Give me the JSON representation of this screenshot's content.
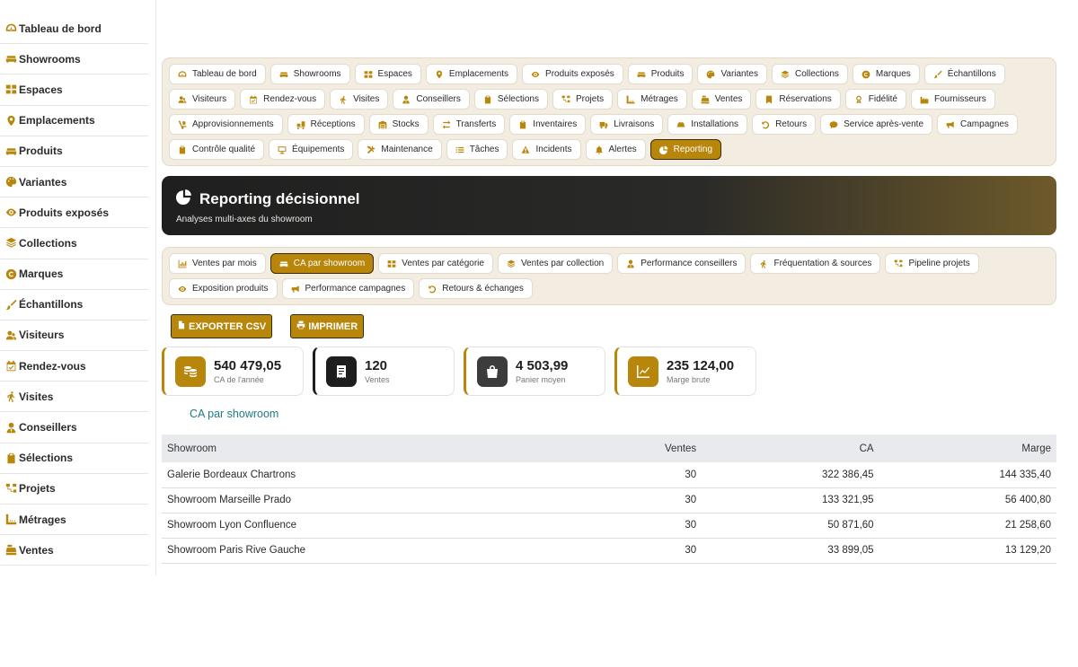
{
  "sidebar": {
    "items": [
      {
        "label": "Tableau de bord",
        "icon": "gauge-icon"
      },
      {
        "label": "Showrooms",
        "icon": "couch-icon"
      },
      {
        "label": "Espaces",
        "icon": "grid-icon"
      },
      {
        "label": "Emplacements",
        "icon": "map-pin-icon"
      },
      {
        "label": "Produits",
        "icon": "couch-icon"
      },
      {
        "label": "Variantes",
        "icon": "palette-icon"
      },
      {
        "label": "Produits exposés",
        "icon": "eye-icon"
      },
      {
        "label": "Collections",
        "icon": "layers-icon"
      },
      {
        "label": "Marques",
        "icon": "copyright-icon"
      },
      {
        "label": "Échantillons",
        "icon": "brush-icon"
      },
      {
        "label": "Visiteurs",
        "icon": "users-icon"
      },
      {
        "label": "Rendez-vous",
        "icon": "calendar-check-icon"
      },
      {
        "label": "Visites",
        "icon": "walking-icon"
      },
      {
        "label": "Conseillers",
        "icon": "user-tie-icon"
      },
      {
        "label": "Sélections",
        "icon": "clipboard-icon"
      },
      {
        "label": "Projets",
        "icon": "diagram-icon"
      },
      {
        "label": "Métrages",
        "icon": "ruler-icon"
      },
      {
        "label": "Ventes",
        "icon": "cash-register-icon"
      }
    ]
  },
  "modules": [
    {
      "label": "Tableau de bord",
      "icon": "gauge-icon"
    },
    {
      "label": "Showrooms",
      "icon": "couch-icon"
    },
    {
      "label": "Espaces",
      "icon": "grid-icon"
    },
    {
      "label": "Emplacements",
      "icon": "map-pin-icon"
    },
    {
      "label": "Produits exposés",
      "icon": "eye-icon"
    },
    {
      "label": "Produits",
      "icon": "couch-icon"
    },
    {
      "label": "Variantes",
      "icon": "palette-icon"
    },
    {
      "label": "Collections",
      "icon": "layers-icon"
    },
    {
      "label": "Marques",
      "icon": "copyright-icon"
    },
    {
      "label": "Échantillons",
      "icon": "brush-icon"
    },
    {
      "label": "Visiteurs",
      "icon": "users-icon"
    },
    {
      "label": "Rendez-vous",
      "icon": "calendar-check-icon"
    },
    {
      "label": "Visites",
      "icon": "walking-icon"
    },
    {
      "label": "Conseillers",
      "icon": "user-tie-icon"
    },
    {
      "label": "Sélections",
      "icon": "clipboard-icon"
    },
    {
      "label": "Projets",
      "icon": "diagram-icon"
    },
    {
      "label": "Métrages",
      "icon": "ruler-icon"
    },
    {
      "label": "Ventes",
      "icon": "cash-register-icon"
    },
    {
      "label": "Réservations",
      "icon": "bookmark-icon"
    },
    {
      "label": "Fidélité",
      "icon": "award-icon"
    },
    {
      "label": "Fournisseurs",
      "icon": "industry-icon"
    },
    {
      "label": "Approvisionnements",
      "icon": "dolly-icon"
    },
    {
      "label": "Réceptions",
      "icon": "truck-loading-icon"
    },
    {
      "label": "Stocks",
      "icon": "warehouse-icon"
    },
    {
      "label": "Transferts",
      "icon": "exchange-icon"
    },
    {
      "label": "Inventaires",
      "icon": "clipboard-check-icon"
    },
    {
      "label": "Livraisons",
      "icon": "truck-icon"
    },
    {
      "label": "Installations",
      "icon": "hard-hat-icon"
    },
    {
      "label": "Retours",
      "icon": "undo-icon"
    },
    {
      "label": "Service après-vente",
      "icon": "comment-icon"
    },
    {
      "label": "Campagnes",
      "icon": "megaphone-icon"
    },
    {
      "label": "Contrôle qualité",
      "icon": "clipboard-icon"
    },
    {
      "label": "Équipements",
      "icon": "monitor-icon"
    },
    {
      "label": "Maintenance",
      "icon": "tools-icon"
    },
    {
      "label": "Tâches",
      "icon": "list-icon"
    },
    {
      "label": "Incidents",
      "icon": "warning-icon"
    },
    {
      "label": "Alertes",
      "icon": "bell-icon"
    },
    {
      "label": "Reporting",
      "icon": "pie-chart-icon",
      "active": true
    }
  ],
  "hero": {
    "title": "Reporting décisionnel",
    "subtitle": "Analyses multi-axes du showroom",
    "icon": "pie-chart-icon"
  },
  "reports": [
    {
      "label": "Ventes par mois",
      "icon": "chart-bar-icon"
    },
    {
      "label": "CA par showroom",
      "icon": "couch-icon",
      "active": true
    },
    {
      "label": "Ventes par catégorie",
      "icon": "grid-icon"
    },
    {
      "label": "Ventes par collection",
      "icon": "layers-icon"
    },
    {
      "label": "Performance conseillers",
      "icon": "user-tie-icon"
    },
    {
      "label": "Fréquentation & sources",
      "icon": "walking-icon"
    },
    {
      "label": "Pipeline projets",
      "icon": "diagram-icon"
    },
    {
      "label": "Exposition produits",
      "icon": "eye-icon"
    },
    {
      "label": "Performance campagnes",
      "icon": "megaphone-icon"
    },
    {
      "label": "Retours & échanges",
      "icon": "undo-icon"
    }
  ],
  "actions": {
    "export_label": "EXPORTER CSV",
    "print_label": "IMPRIMER"
  },
  "kpis": [
    {
      "value": "540 479,05",
      "label": "CA de l'année",
      "icon": "coins-icon",
      "tone": "#b8860b"
    },
    {
      "value": "120",
      "label": "Ventes",
      "icon": "receipt-icon",
      "tone": "#1e1e1e"
    },
    {
      "value": "4 503,99",
      "label": "Panier moyen",
      "icon": "shopping-bag-icon",
      "tone": "#3c3c3c"
    },
    {
      "value": "235 124,00",
      "label": "Marge brute",
      "icon": "chart-line-icon",
      "tone": "#b8860b"
    }
  ],
  "section_title": "CA par showroom",
  "table": {
    "headers": [
      "Showroom",
      "Ventes",
      "CA",
      "Marge"
    ],
    "rows": [
      [
        "Galerie Bordeaux Chartrons",
        "30",
        "322 386,45",
        "144 335,40"
      ],
      [
        "Showroom Marseille Prado",
        "30",
        "133 321,95",
        "56 400,80"
      ],
      [
        "Showroom Lyon Confluence",
        "30",
        "50 871,60",
        "21 258,60"
      ],
      [
        "Showroom Paris Rive Gauche",
        "30",
        "33 899,05",
        "13 129,20"
      ]
    ]
  },
  "colors": {
    "accent": "#b8860b",
    "dark": "#1e1e1e",
    "link": "#1d7a86"
  }
}
